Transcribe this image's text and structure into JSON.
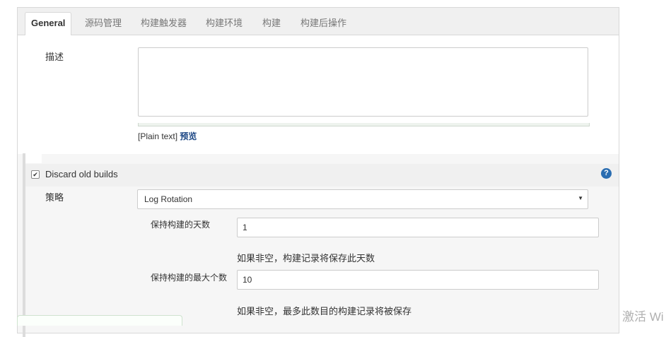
{
  "tabs": [
    {
      "label": "General",
      "active": true
    },
    {
      "label": "源码管理"
    },
    {
      "label": "构建触发器"
    },
    {
      "label": "构建环境"
    },
    {
      "label": "构建"
    },
    {
      "label": "构建后操作"
    }
  ],
  "description": {
    "label": "描述",
    "value": "",
    "format_note": "[Plain text]",
    "preview_link": "预览"
  },
  "discard_old_builds": {
    "label": "Discard old builds",
    "checked": true,
    "help_icon": "?"
  },
  "strategy": {
    "label": "策略",
    "selected": "Log Rotation",
    "arrow": "▼"
  },
  "days_to_keep": {
    "label": "保持构建的天数",
    "value": "1",
    "hint": "如果非空，构建记录将保存此天数"
  },
  "max_builds": {
    "label": "保持构建的最大个数",
    "value": "10",
    "hint": "如果非空，最多此数目的构建记录将被保存"
  },
  "watermark": "激活 Wi",
  "colors": {
    "link": "#204a87",
    "help_icon": "#2a6db1"
  }
}
